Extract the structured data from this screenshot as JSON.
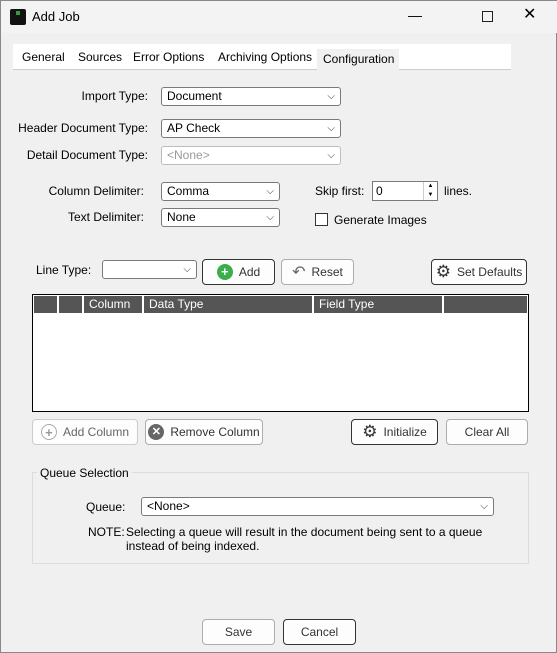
{
  "window": {
    "title": "Add Job",
    "icon": "spc-logo-icon"
  },
  "tabs": [
    {
      "label": "General"
    },
    {
      "label": "Sources"
    },
    {
      "label": "Error Options"
    },
    {
      "label": "Archiving Options"
    },
    {
      "label": "Configuration",
      "selected": true
    }
  ],
  "form": {
    "import_type": {
      "label": "Import Type:",
      "value": "Document"
    },
    "header_doc_type": {
      "label": "Header Document Type:",
      "value": "AP Check"
    },
    "detail_doc_type": {
      "label": "Detail Document Type:",
      "value": "<None>"
    },
    "column_delimiter": {
      "label": "Column Delimiter:",
      "value": "Comma"
    },
    "text_delimiter": {
      "label": "Text Delimiter:",
      "value": "None"
    },
    "skip_first": {
      "label": "Skip first:",
      "value": "0",
      "suffix": "lines."
    },
    "generate_images": {
      "label": "Generate Images",
      "checked": false
    }
  },
  "line_type": {
    "label": "Line Type:",
    "value": "",
    "add": "Add",
    "reset": "Reset",
    "set_defaults": "Set Defaults"
  },
  "grid": {
    "columns": [
      "",
      "",
      "Column",
      "Data Type",
      "Field Type",
      ""
    ],
    "rows": []
  },
  "grid_buttons": {
    "add_column": "Add Column",
    "remove_column": "Remove Column",
    "initialize": "Initialize",
    "clear_all": "Clear All"
  },
  "queue": {
    "group": "Queue Selection",
    "label": "Queue:",
    "value": "<None>",
    "note_label": "NOTE:",
    "note_line1": "Selecting a queue will result in the document being sent to a queue",
    "note_line2": "instead of being indexed."
  },
  "footer": {
    "save": "Save",
    "cancel": "Cancel"
  }
}
